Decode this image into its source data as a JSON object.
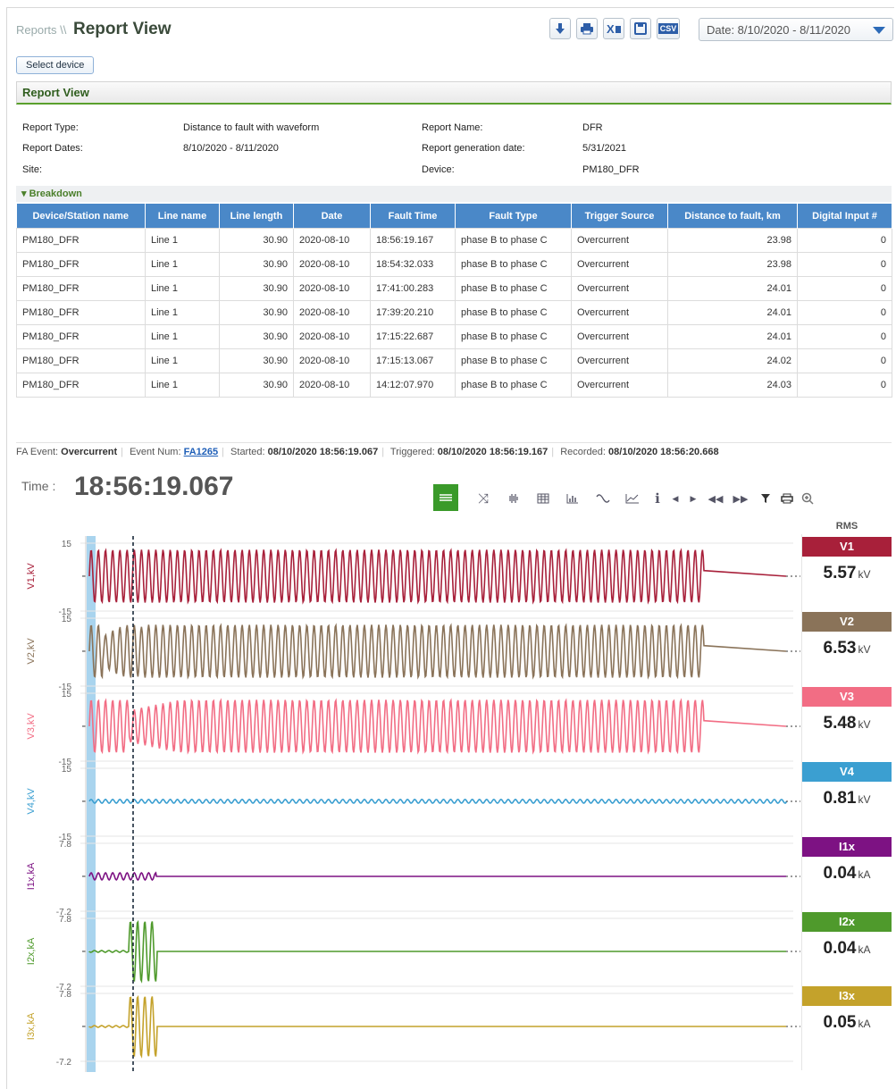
{
  "header": {
    "breadcrumb_root": "Reports",
    "breadcrumb_sep": "\\\\",
    "title": "Report View",
    "date_range": "Date: 8/10/2020 - 8/11/2020",
    "csv_label": "CSV"
  },
  "select_device_label": "Select device",
  "panel_title": "Report View",
  "info": {
    "report_type_label": "Report Type:",
    "report_type": "Distance to fault with waveform",
    "report_dates_label": "Report Dates:",
    "report_dates": "8/10/2020 - 8/11/2020",
    "site_label": "Site:",
    "site": "",
    "report_name_label": "Report Name:",
    "report_name": "DFR",
    "generation_date_label": "Report generation date:",
    "generation_date": "5/31/2021",
    "device_label": "Device:",
    "device": "PM180_DFR"
  },
  "breakdown_label": "▾ Breakdown",
  "table": {
    "columns": [
      "Device/Station name",
      "Line name",
      "Line length",
      "Date",
      "Fault Time",
      "Fault Type",
      "Trigger Source",
      "Distance to fault, km",
      "Digital Input #"
    ],
    "rows": [
      [
        "PM180_DFR",
        "Line 1",
        "30.90",
        "2020-08-10",
        "18:56:19.167",
        "phase B to phase C",
        "Overcurrent",
        "23.98",
        "0"
      ],
      [
        "PM180_DFR",
        "Line 1",
        "30.90",
        "2020-08-10",
        "18:54:32.033",
        "phase B to phase C",
        "Overcurrent",
        "23.98",
        "0"
      ],
      [
        "PM180_DFR",
        "Line 1",
        "30.90",
        "2020-08-10",
        "17:41:00.283",
        "phase B to phase C",
        "Overcurrent",
        "24.01",
        "0"
      ],
      [
        "PM180_DFR",
        "Line 1",
        "30.90",
        "2020-08-10",
        "17:39:20.210",
        "phase B to phase C",
        "Overcurrent",
        "24.01",
        "0"
      ],
      [
        "PM180_DFR",
        "Line 1",
        "30.90",
        "2020-08-10",
        "17:15:22.687",
        "phase B to phase C",
        "Overcurrent",
        "24.01",
        "0"
      ],
      [
        "PM180_DFR",
        "Line 1",
        "30.90",
        "2020-08-10",
        "17:15:13.067",
        "phase B to phase C",
        "Overcurrent",
        "24.02",
        "0"
      ],
      [
        "PM180_DFR",
        "Line 1",
        "30.90",
        "2020-08-10",
        "14:12:07.970",
        "phase B to phase C",
        "Overcurrent",
        "24.03",
        "0"
      ]
    ]
  },
  "event": {
    "fa_event_label": "FA Event:",
    "fa_event": "Overcurrent",
    "event_num_label": "Event Num:",
    "event_num": "FA1265",
    "started_label": "Started:",
    "started": "08/10/2020 18:56:19.067",
    "triggered_label": "Triggered:",
    "triggered": "08/10/2020 18:56:19.167",
    "recorded_label": "Recorded:",
    "recorded": "08/10/2020 18:56:20.668"
  },
  "time_label": "Time :",
  "time_value": "18:56:19.067",
  "toolbar_icons": [
    "waveform-view-icon",
    "shuffle-icon",
    "harmonics-icon",
    "table-icon",
    "bar-chart-icon",
    "sine-icon",
    "line-chart-icon",
    "info-icon",
    "step-back-icon",
    "step-forward-icon",
    "rewind-icon",
    "fast-forward-icon",
    "filter-icon",
    "print-icon",
    "zoom-icon"
  ],
  "rms_header": "RMS",
  "channels": [
    {
      "name": "V1",
      "axis_label": "V1,kV",
      "ymax": "15",
      "ymin": "-15",
      "rms": "5.57",
      "unit": "kV",
      "color": "#a8203a"
    },
    {
      "name": "V2",
      "axis_label": "V2,kV",
      "ymax": "15",
      "ymin": "-15",
      "rms": "6.53",
      "unit": "kV",
      "color": "#8a7359"
    },
    {
      "name": "V3",
      "axis_label": "V3,kV",
      "ymax": "15",
      "ymin": "-15",
      "rms": "5.48",
      "unit": "kV",
      "color": "#f26d84"
    },
    {
      "name": "V4",
      "axis_label": "V4,kV",
      "ymax": "15",
      "ymin": "-15",
      "rms": "0.81",
      "unit": "kV",
      "color": "#3b9fd1"
    },
    {
      "name": "I1x",
      "axis_label": "I1x,kA",
      "ymax": "7.8",
      "ymin": "-7.2",
      "rms": "0.04",
      "unit": "kA",
      "color": "#7d1283"
    },
    {
      "name": "I2x",
      "axis_label": "I2x,kA",
      "ymax": "7.8",
      "ymin": "-7.2",
      "rms": "0.04",
      "unit": "kA",
      "color": "#4f9a2c"
    },
    {
      "name": "I3x",
      "axis_label": "I3x,kA",
      "ymax": "7.8",
      "ymin": "-7.2",
      "rms": "0.05",
      "unit": "kA",
      "color": "#c4a22b"
    }
  ],
  "colors": {
    "accent": "#4a88c8",
    "active_tool": "#3a9a2a",
    "panel_border": "#5aa02c"
  }
}
